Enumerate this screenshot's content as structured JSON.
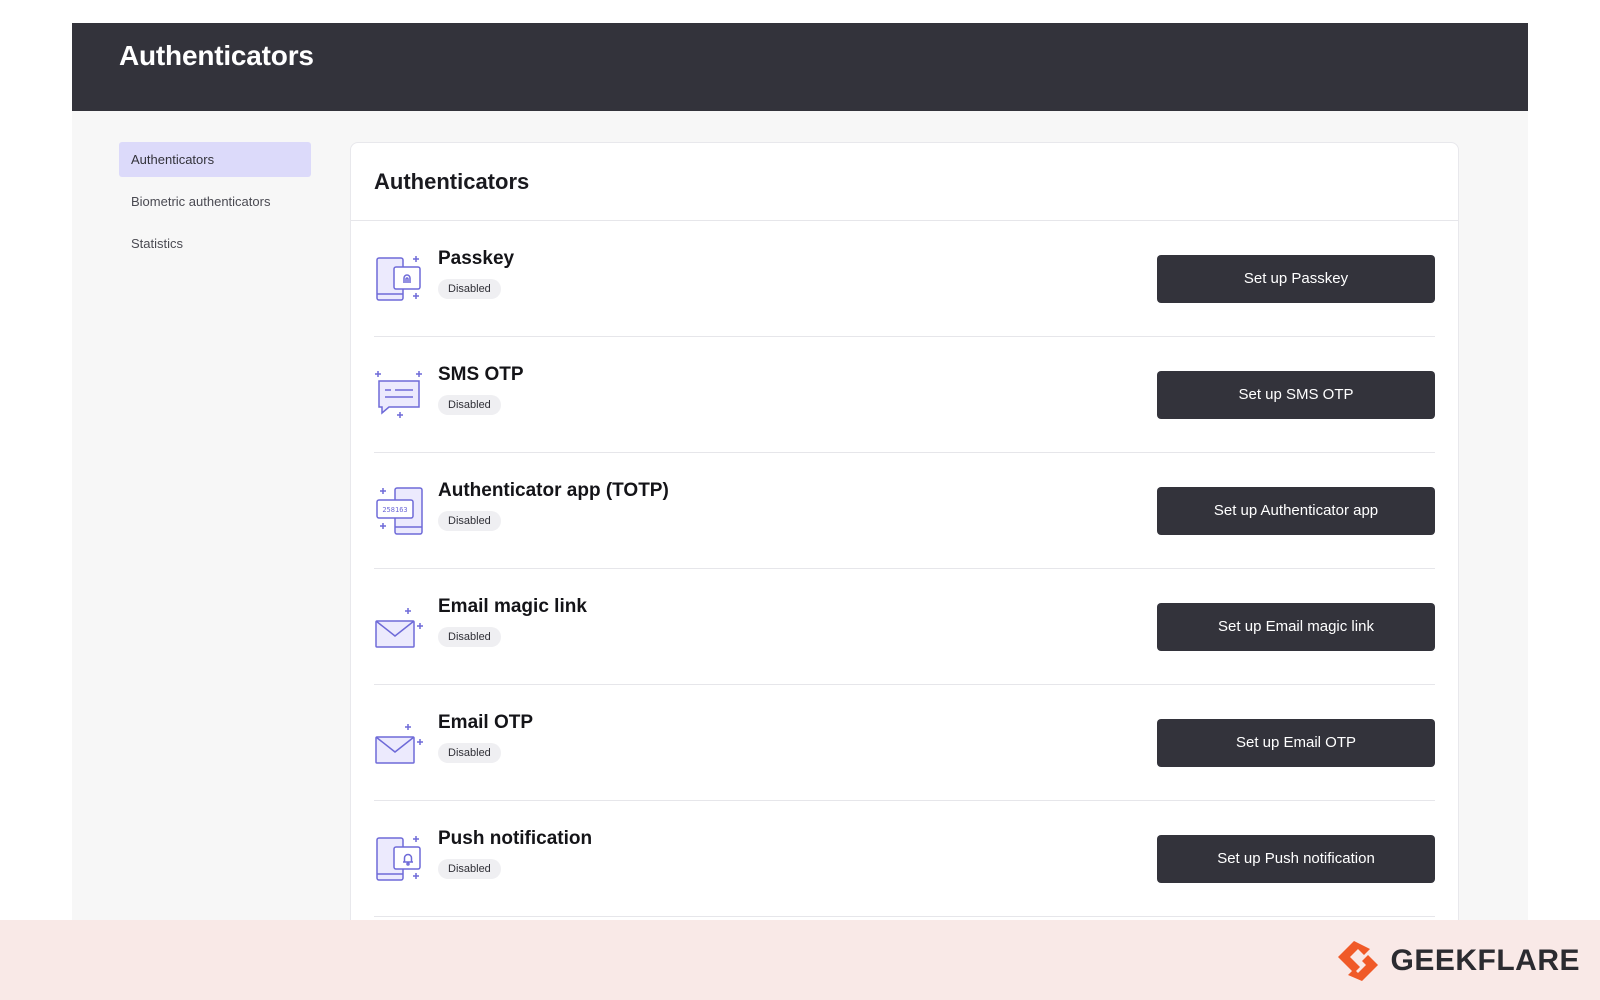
{
  "header": {
    "title": "Authenticators"
  },
  "sidebar": {
    "items": [
      {
        "label": "Authenticators",
        "active": true
      },
      {
        "label": "Biometric authenticators",
        "active": false
      },
      {
        "label": "Statistics",
        "active": false
      }
    ]
  },
  "main": {
    "title": "Authenticators",
    "authenticators": [
      {
        "name": "Passkey",
        "status": "Disabled",
        "button": "Set up Passkey",
        "icon": "passkey-icon"
      },
      {
        "name": "SMS OTP",
        "status": "Disabled",
        "button": "Set up SMS OTP",
        "icon": "sms-message-icon"
      },
      {
        "name": "Authenticator app (TOTP)",
        "status": "Disabled",
        "button": "Set up Authenticator app",
        "icon": "authenticator-app-icon",
        "icon_code": "258163"
      },
      {
        "name": "Email magic link",
        "status": "Disabled",
        "button": "Set up Email magic link",
        "icon": "envelope-icon"
      },
      {
        "name": "Email OTP",
        "status": "Disabled",
        "button": "Set up Email OTP",
        "icon": "envelope-icon"
      },
      {
        "name": "Push notification",
        "status": "Disabled",
        "button": "Set up Push notification",
        "icon": "push-notification-icon"
      }
    ]
  },
  "branding": {
    "name": "GEEKFLARE",
    "icon": "geekflare-logo-icon"
  },
  "colors": {
    "header_bg": "#33333b",
    "button_bg": "#33333b",
    "active_nav_bg": "#dcdafa",
    "icon_accent": "#6e6ad8",
    "footer_bg": "#f9e9e7",
    "brand_orange": "#f05a28"
  }
}
